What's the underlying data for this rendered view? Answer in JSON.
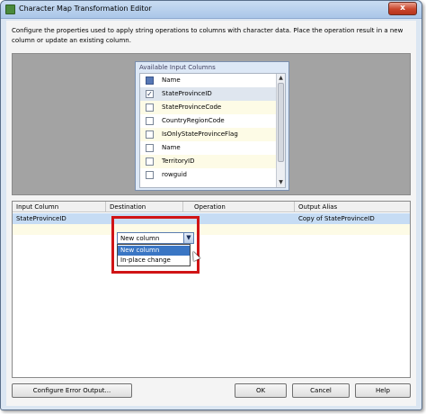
{
  "window": {
    "title": "Character Map Transformation Editor",
    "close_glyph": "x"
  },
  "description": "Configure the properties used to apply string operations to columns with character data. Place the operation result in a new column or update an existing column.",
  "available_columns": {
    "title": "Available Input Columns",
    "header_label": "Name",
    "items": [
      {
        "label": "StateProvinceID",
        "checked": true
      },
      {
        "label": "StateProvinceCode",
        "checked": false
      },
      {
        "label": "CountryRegionCode",
        "checked": false
      },
      {
        "label": "IsOnlyStateProvinceFlag",
        "checked": false
      },
      {
        "label": "Name",
        "checked": false
      },
      {
        "label": "TerritoryID",
        "checked": false
      },
      {
        "label": "rowguid",
        "checked": false
      }
    ]
  },
  "grid": {
    "columns": [
      "Input Column",
      "Destination",
      "Operation",
      "Output Alias"
    ],
    "rows": [
      {
        "input_column": "StateProvinceID",
        "destination": "New column",
        "operation": "",
        "output_alias": "Copy of StateProvinceID"
      }
    ],
    "destination_options": [
      "New column",
      "In-place change"
    ],
    "selected_option": "New column"
  },
  "buttons": {
    "configure_error_output": "Configure Error Output...",
    "ok": "OK",
    "cancel": "Cancel",
    "help": "Help"
  },
  "colors": {
    "highlight": "#d01416",
    "selection": "#3a76c4"
  }
}
